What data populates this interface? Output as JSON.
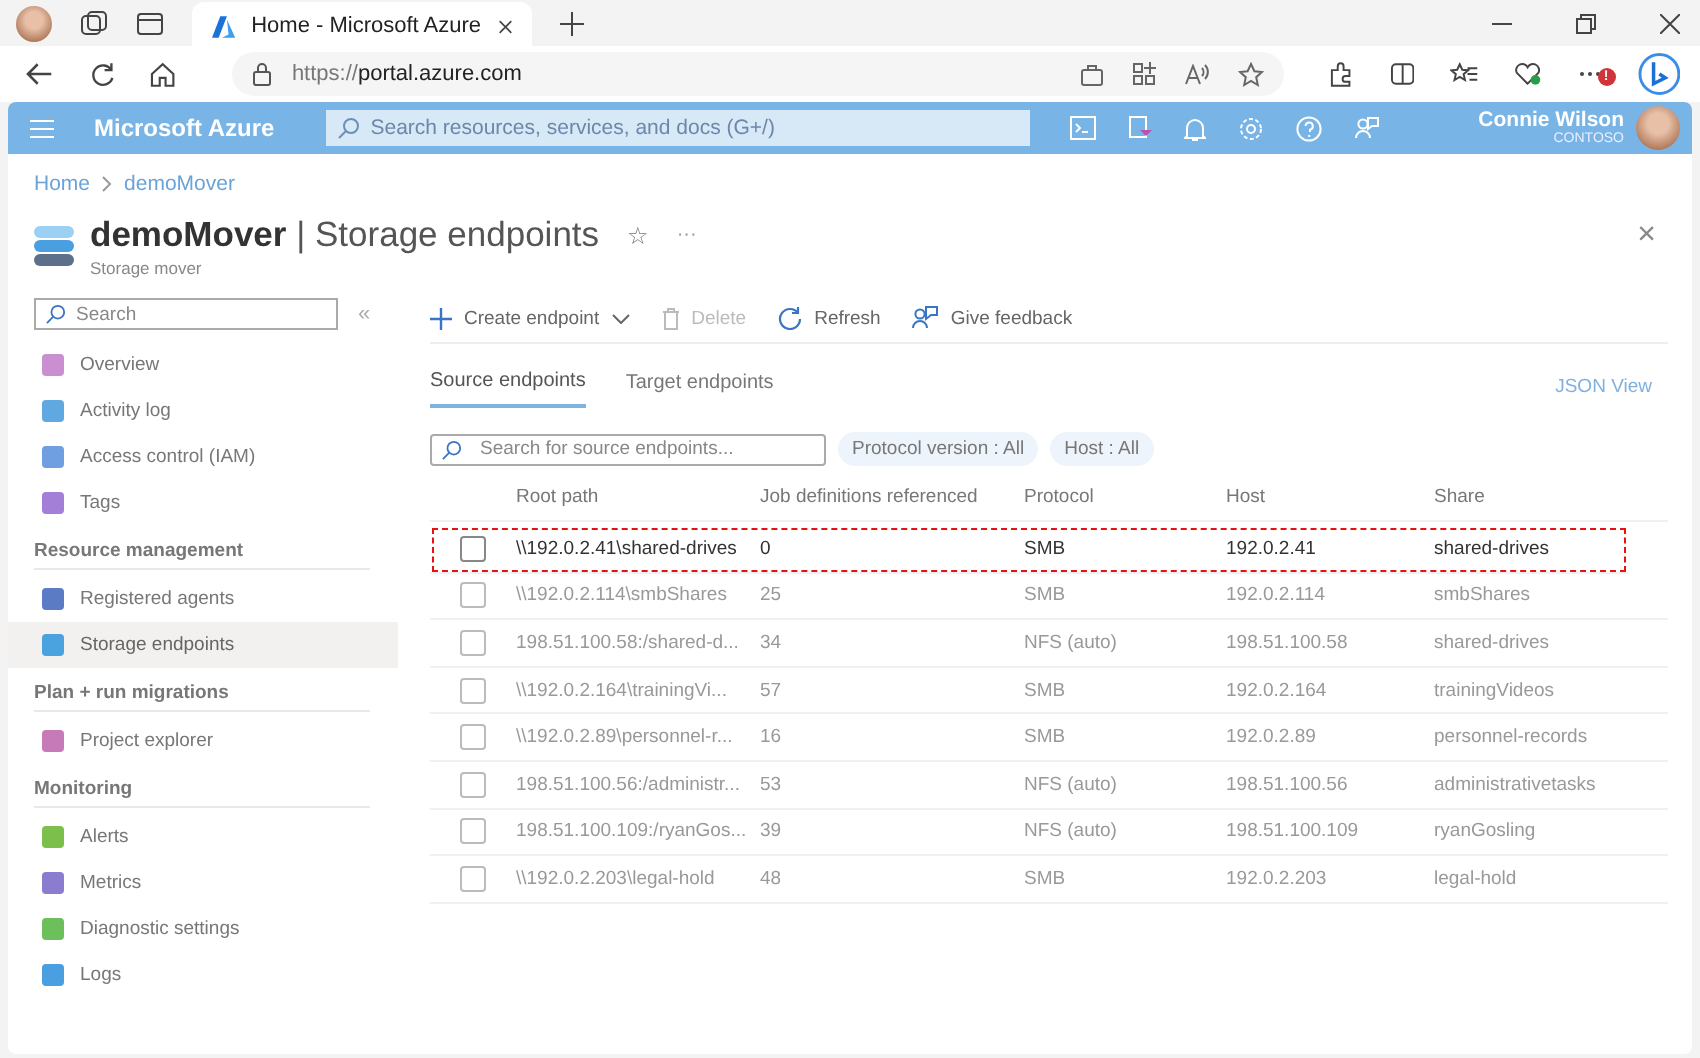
{
  "browser": {
    "tab_title": "Home - Microsoft Azure",
    "url_scheme": "https://",
    "url_host": "portal.azure.com",
    "notification_badge": "!"
  },
  "header": {
    "brand": "Microsoft Azure",
    "search_placeholder": "Search resources, services, and docs (G+/)",
    "user_name": "Connie Wilson",
    "user_org": "CONTOSO"
  },
  "breadcrumb": [
    "Home",
    "demoMover"
  ],
  "page": {
    "resource": "demoMover",
    "separator": "|",
    "title": "Storage endpoints",
    "subtitle": "Storage mover",
    "star": "☆",
    "more": "···",
    "close": "×"
  },
  "sidebar": {
    "search_placeholder": "Search",
    "collapse": "«",
    "items": [
      {
        "kind": "item",
        "label": "Overview",
        "selected": false
      },
      {
        "kind": "item",
        "label": "Activity log",
        "selected": false
      },
      {
        "kind": "item",
        "label": "Access control (IAM)",
        "selected": false
      },
      {
        "kind": "item",
        "label": "Tags",
        "selected": false
      },
      {
        "kind": "section",
        "label": "Resource management"
      },
      {
        "kind": "item",
        "label": "Registered agents",
        "selected": false
      },
      {
        "kind": "item",
        "label": "Storage endpoints",
        "selected": true
      },
      {
        "kind": "section",
        "label": "Plan + run migrations"
      },
      {
        "kind": "item",
        "label": "Project explorer",
        "selected": false
      },
      {
        "kind": "section",
        "label": "Monitoring"
      },
      {
        "kind": "item",
        "label": "Alerts",
        "selected": false
      },
      {
        "kind": "item",
        "label": "Metrics",
        "selected": false
      },
      {
        "kind": "item",
        "label": "Diagnostic settings",
        "selected": false
      },
      {
        "kind": "item",
        "label": "Logs",
        "selected": false
      }
    ]
  },
  "toolbar": [
    {
      "label": "Create endpoint",
      "disabled": false
    },
    {
      "label": "Delete",
      "disabled": true
    },
    {
      "label": "Refresh",
      "disabled": false
    },
    {
      "label": "Give feedback",
      "disabled": false
    }
  ],
  "tabs": [
    {
      "label": "Source endpoints",
      "selected": true
    },
    {
      "label": "Target endpoints",
      "selected": false
    }
  ],
  "json_view": "JSON View",
  "filter": {
    "search_placeholder": "Search for source endpoints...",
    "pills": [
      "Protocol version : All",
      "Host : All"
    ]
  },
  "table": {
    "columns": [
      "Root path",
      "Job definitions referenced",
      "Protocol",
      "Host",
      "Share"
    ],
    "rows": [
      {
        "cells": [
          "\\\\192.0.2.41\\shared-drives",
          "0",
          "SMB",
          "192.0.2.41",
          "shared-drives"
        ],
        "checked": false,
        "highlighted": true
      },
      {
        "cells": [
          "\\\\192.0.2.114\\smbShares",
          "25",
          "SMB",
          "192.0.2.114",
          "smbShares"
        ],
        "checked": false,
        "highlighted": false
      },
      {
        "cells": [
          "198.51.100.58:/shared-d...",
          "34",
          "NFS (auto)",
          "198.51.100.58",
          "shared-drives"
        ],
        "checked": false,
        "highlighted": false
      },
      {
        "cells": [
          "\\\\192.0.2.164\\trainingVi...",
          "57",
          "SMB",
          "192.0.2.164",
          "trainingVideos"
        ],
        "checked": false,
        "highlighted": false
      },
      {
        "cells": [
          "\\\\192.0.2.89\\personnel-r...",
          "16",
          "SMB",
          "192.0.2.89",
          "personnel-records"
        ],
        "checked": false,
        "highlighted": false
      },
      {
        "cells": [
          "198.51.100.56:/administr...",
          "53",
          "NFS (auto)",
          "198.51.100.56",
          "administrativetasks"
        ],
        "checked": false,
        "highlighted": false
      },
      {
        "cells": [
          "198.51.100.109:/ryanGos...",
          "39",
          "NFS (auto)",
          "198.51.100.109",
          "ryanGosling"
        ],
        "checked": false,
        "highlighted": false
      },
      {
        "cells": [
          "\\\\192.0.2.203\\legal-hold",
          "48",
          "SMB",
          "192.0.2.203",
          "legal-hold"
        ],
        "checked": false,
        "highlighted": false
      }
    ]
  }
}
